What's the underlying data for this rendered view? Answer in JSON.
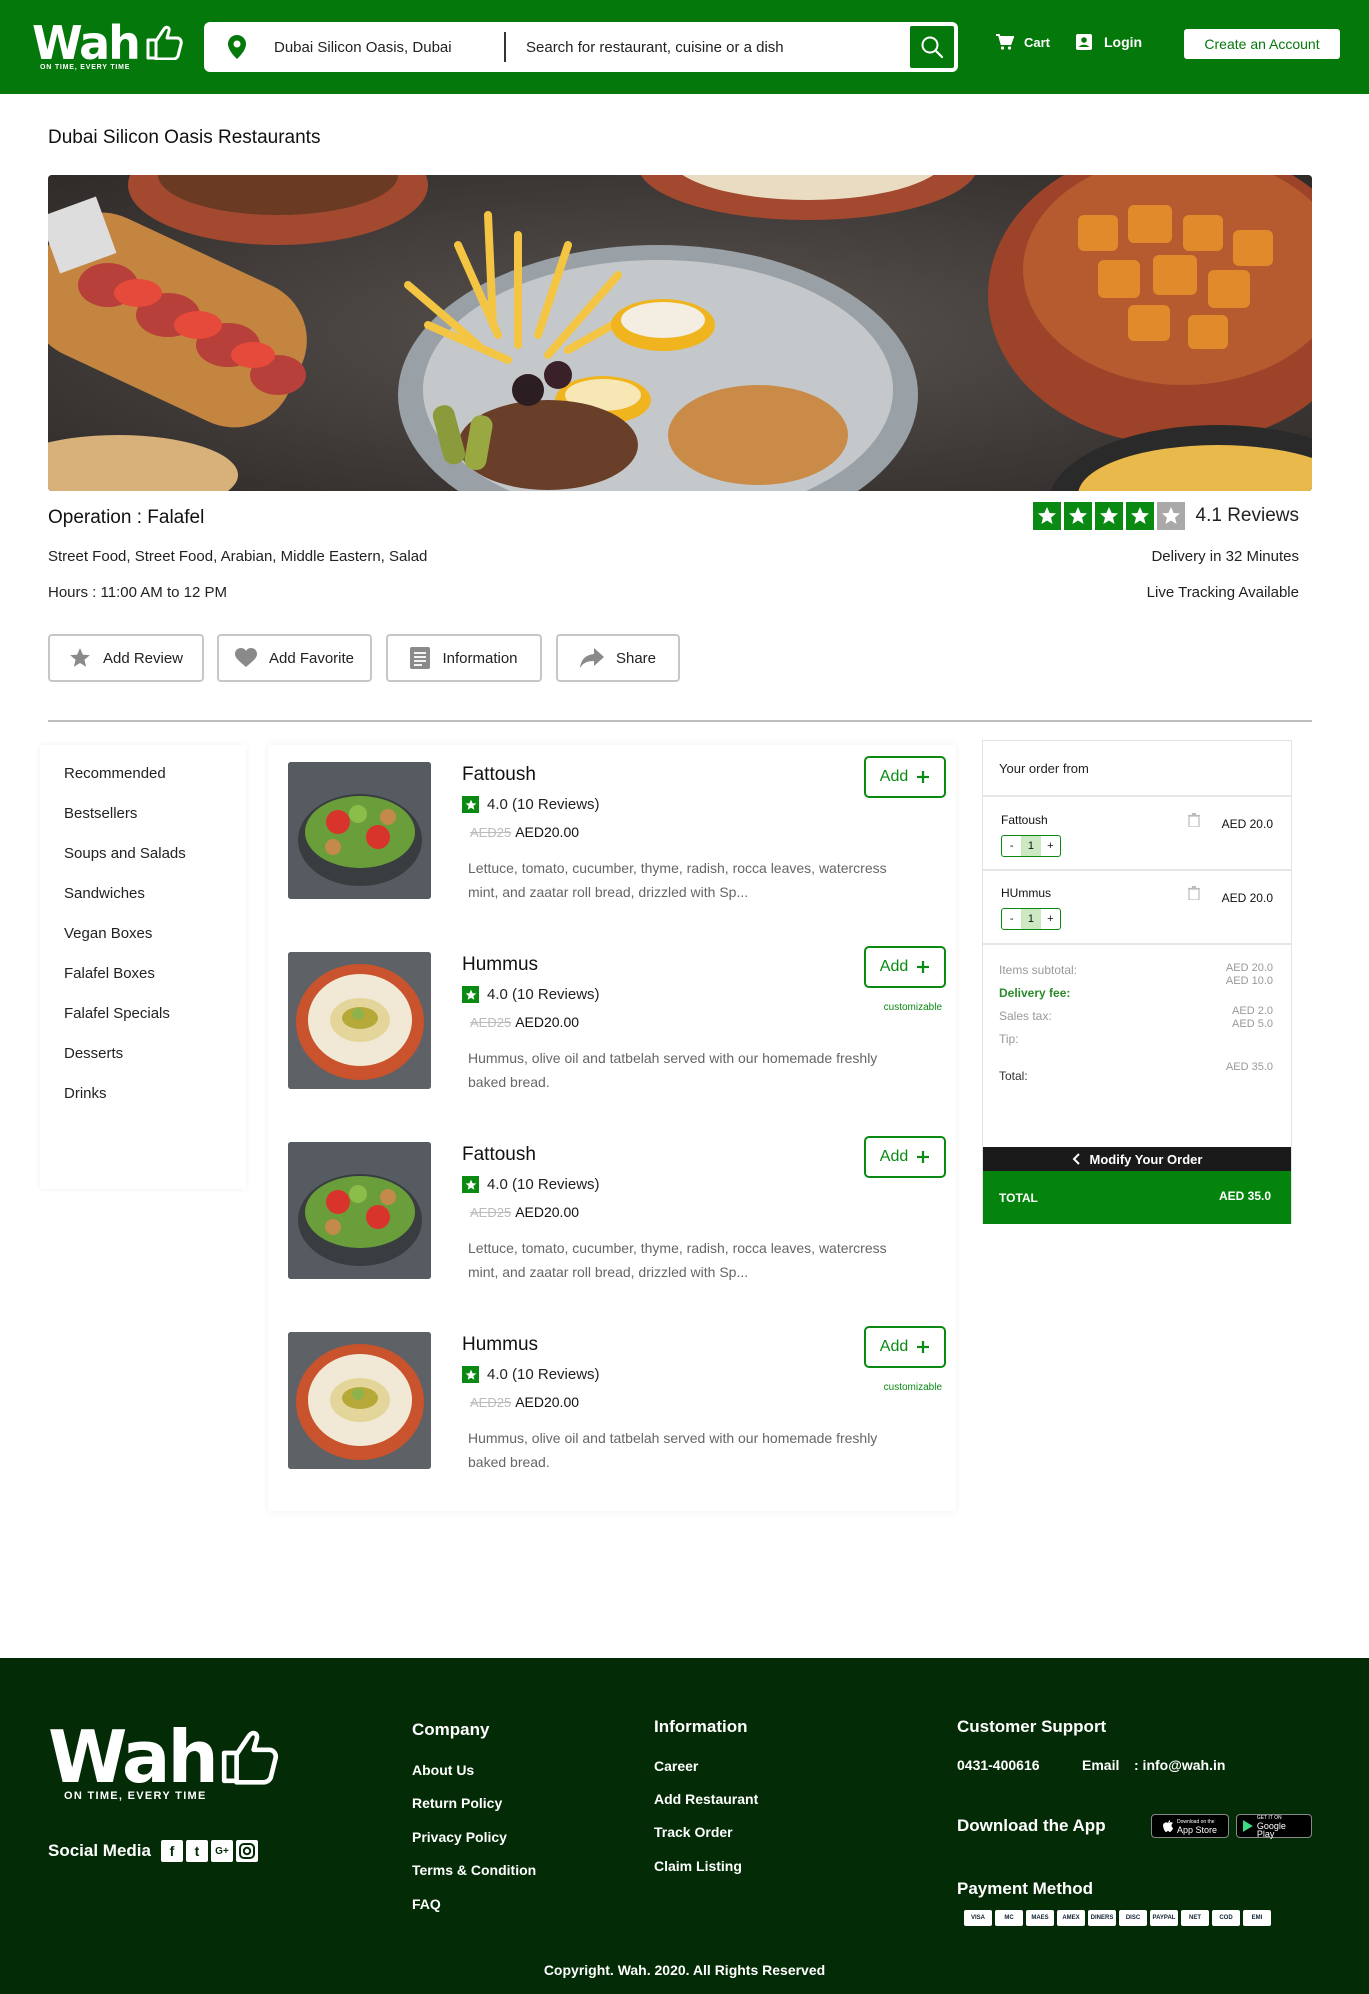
{
  "brand": {
    "name": "Wah",
    "tagline": "ON TIME, EVERY TIME",
    "primary_color": "#04780a",
    "footer_color": "#032b06"
  },
  "header": {
    "location": "Dubai Silicon Oasis, Dubai",
    "search_placeholder": "Search for restaurant, cuisine or a dish",
    "cart_label": "Cart",
    "login_label": "Login",
    "create_account_label": "Create an Account"
  },
  "page": {
    "title": "Dubai Silicon Oasis Restaurants"
  },
  "restaurant": {
    "name": "Operation : Falafel",
    "cuisines": "Street Food, Street Food, Arabian, Middle Eastern, Salad",
    "hours": "Hours : 11:00 AM to 12 PM",
    "rating_stars": 4,
    "rating_text": "4.1 Reviews",
    "delivery": "Delivery in 32 Minutes",
    "tracking": "Live Tracking Available"
  },
  "actions": {
    "add_review": "Add Review",
    "add_favorite": "Add Favorite",
    "information": "Information",
    "share": "Share"
  },
  "categories": [
    "Recommended",
    "Bestsellers",
    "Soups and Salads",
    "Sandwiches",
    "Vegan Boxes",
    "Falafel Boxes",
    "Falafel Specials",
    "Desserts",
    "Drinks"
  ],
  "menu": [
    {
      "name": "Fattoush",
      "rating": "4.0 (10 Reviews)",
      "old_price": "AED25",
      "price": "AED20.00",
      "description": "Lettuce, tomato, cucumber, thyme, radish, rocca leaves, watercress mint, and zaatar roll bread, drizzled with Sp...",
      "add_label": "Add",
      "customizable": "",
      "image": "salad"
    },
    {
      "name": "Hummus",
      "rating": "4.0 (10 Reviews)",
      "old_price": "AED25",
      "price": "AED20.00",
      "description": "Hummus, olive oil and tatbelah served with our homemade freshly baked bread.",
      "add_label": "Add",
      "customizable": "customizable",
      "image": "hummus"
    },
    {
      "name": "Fattoush",
      "rating": "4.0 (10 Reviews)",
      "old_price": "AED25",
      "price": "AED20.00",
      "description": "Lettuce, tomato, cucumber, thyme, radish, rocca leaves, watercress mint, and zaatar roll bread, drizzled with Sp...",
      "add_label": "Add",
      "customizable": "",
      "image": "salad"
    },
    {
      "name": "Hummus",
      "rating": "4.0 (10 Reviews)",
      "old_price": "AED25",
      "price": "AED20.00",
      "description": "Hummus, olive oil and tatbelah served with our homemade freshly baked bread.",
      "add_label": "Add",
      "customizable": "customizable",
      "image": "hummus"
    }
  ],
  "order": {
    "heading": "Your order from",
    "items": [
      {
        "name": "Fattoush",
        "qty": "1",
        "price": "AED 20.0"
      },
      {
        "name": "HUmmus",
        "qty": "1",
        "price": "AED 20.0"
      }
    ],
    "summary": {
      "subtotal_label": "Items subtotal:",
      "delivery_label": "Delivery fee:",
      "tax_label": "Sales tax:",
      "tip_label": "Tip:",
      "total_label": "Total:",
      "subtotal_value": "AED 20.0",
      "delivery_value": "AED 10.0",
      "tax_value": "AED 2.0",
      "tip_value": "AED 5.0",
      "total_value": "AED 35.0"
    },
    "modify_label": "Modify Your Order",
    "total_bar_label": "TOTAL",
    "total_bar_value": "AED 35.0"
  },
  "footer": {
    "social_label": "Social Media",
    "company_title": "Company",
    "company_links": [
      "About Us",
      "Return Policy",
      "Privacy Policy",
      "Terms & Condition",
      "FAQ"
    ],
    "info_title": "Information",
    "info_links": [
      "Career",
      "Add Restaurant",
      "Track Order",
      "Claim Listing"
    ],
    "support_title": "Customer Support",
    "phone": "0431-400616",
    "email_label": "Email",
    "email": ": info@wah.in",
    "download_title": "Download the App",
    "app_store": "App Store",
    "app_store_small": "Download on the",
    "google_play": "Google Play",
    "google_play_small": "GET IT ON",
    "payment_title": "Payment Method",
    "payment_methods": [
      "VISA",
      "MC",
      "MAES",
      "AMEX",
      "DINERS",
      "DISC",
      "PAYPAL",
      "NET",
      "COD",
      "EMI"
    ],
    "copyright": "Copyright. Wah. 2020. All Rights Reserved"
  }
}
